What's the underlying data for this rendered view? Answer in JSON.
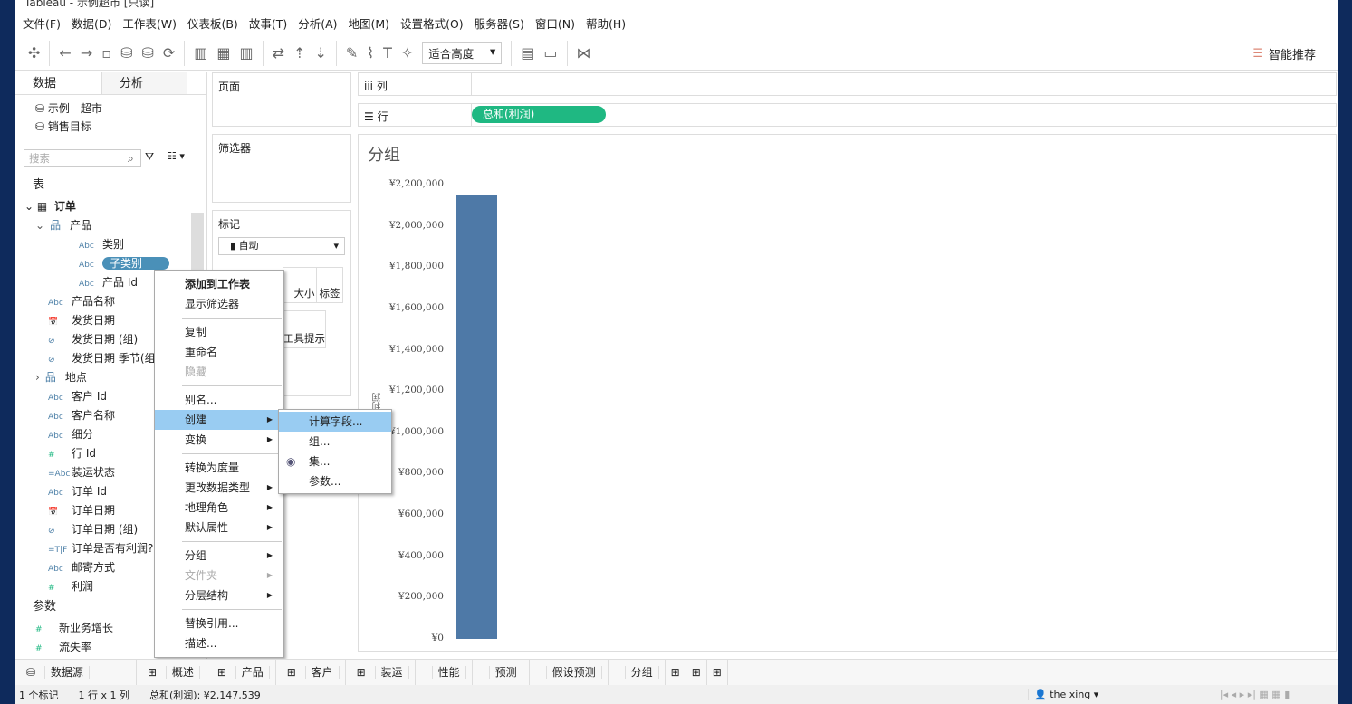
{
  "window": {
    "title": "Tableau - 示例超市 [只读]"
  },
  "menu": [
    "文件(F)",
    "数据(D)",
    "工作表(W)",
    "仪表板(B)",
    "故事(T)",
    "分析(A)",
    "地图(M)",
    "设置格式(O)",
    "服务器(S)",
    "窗口(N)",
    "帮助(H)"
  ],
  "toolbar": {
    "fit": "适合高度",
    "smart": "智能推荐"
  },
  "left": {
    "tab_data": "数据",
    "tab_analysis": "分析",
    "sources": [
      "示例 - 超市",
      "销售目标"
    ],
    "search_placeholder": "搜索",
    "tables_label": "表",
    "table": "订单",
    "params_label": "参数",
    "fields": [
      {
        "type": "",
        "name": "产品"
      },
      {
        "type": "Abc",
        "name": "类别"
      },
      {
        "type": "Abc",
        "name": "子类别"
      },
      {
        "type": "Abc",
        "name": "产品 Id"
      },
      {
        "type": "Abc",
        "name": "产品名称"
      },
      {
        "type": "📅",
        "name": "发货日期"
      },
      {
        "type": "⊘",
        "name": "发货日期 (组)"
      },
      {
        "type": "⊘",
        "name": "发货日期 季节(组)"
      },
      {
        "type": "",
        "name": "地点"
      },
      {
        "type": "Abc",
        "name": "客户 Id"
      },
      {
        "type": "Abc",
        "name": "客户名称"
      },
      {
        "type": "Abc",
        "name": "细分"
      },
      {
        "type": "#",
        "name": "行 Id"
      },
      {
        "type": "=Abc",
        "name": "装运状态"
      },
      {
        "type": "Abc",
        "name": "订单 Id"
      },
      {
        "type": "📅",
        "name": "订单日期"
      },
      {
        "type": "⊘",
        "name": "订单日期 (组)"
      },
      {
        "type": "=T|F",
        "name": "订单是否有利润?"
      },
      {
        "type": "Abc",
        "name": "邮寄方式"
      },
      {
        "type": "#",
        "name": "利润"
      }
    ],
    "params": [
      "新业务增长",
      "流失率"
    ]
  },
  "cards": {
    "pages": "页面",
    "filters": "筛选器",
    "marks": "标记",
    "mark_type": "自动",
    "size": "大小",
    "label": "标签",
    "tooltip": "工具提示"
  },
  "shelves": {
    "columns": "列",
    "rows": "行",
    "row_pill": "总和(利润)"
  },
  "view": {
    "title": "分组",
    "axis_label": "利润"
  },
  "chart_data": {
    "type": "bar",
    "categories": [
      ""
    ],
    "values": [
      2147539
    ],
    "ylim": [
      0,
      2200000
    ],
    "yticks": [
      "¥2,200,000",
      "¥2,000,000",
      "¥1,800,000",
      "¥1,600,000",
      "¥1,400,000",
      "¥1,200,000",
      "¥1,000,000",
      "¥800,000",
      "¥600,000",
      "¥400,000",
      "¥200,000",
      "¥0"
    ],
    "color": "#4e79a7"
  },
  "context_menu": [
    {
      "label": "添加到工作表",
      "bold": true
    },
    {
      "label": "显示筛选器"
    },
    {
      "sep": true
    },
    {
      "label": "复制"
    },
    {
      "label": "重命名"
    },
    {
      "label": "隐藏",
      "disabled": true
    },
    {
      "sep": true
    },
    {
      "label": "别名..."
    },
    {
      "label": "创建",
      "sub": true,
      "hl": true
    },
    {
      "label": "变换",
      "sub": true
    },
    {
      "sep": true
    },
    {
      "label": "转换为度量"
    },
    {
      "label": "更改数据类型",
      "sub": true
    },
    {
      "label": "地理角色",
      "sub": true
    },
    {
      "label": "默认属性",
      "sub": true
    },
    {
      "sep": true
    },
    {
      "label": "分组",
      "sub": true
    },
    {
      "label": "文件夹",
      "sub": true,
      "disabled": true
    },
    {
      "label": "分层结构",
      "sub": true
    },
    {
      "sep": true
    },
    {
      "label": "替换引用..."
    },
    {
      "label": "描述..."
    }
  ],
  "submenu": [
    "计算字段...",
    "组...",
    "集...",
    "参数..."
  ],
  "bottom_tabs": [
    "数据源",
    "概述",
    "产品",
    "客户",
    "装运",
    "性能",
    "预测",
    "假设预测",
    "分组"
  ],
  "status": {
    "marks": "1 个标记",
    "dims": "1 行 x 1 列",
    "sum": "总和(利润): ¥2,147,539",
    "user": "the xing"
  }
}
